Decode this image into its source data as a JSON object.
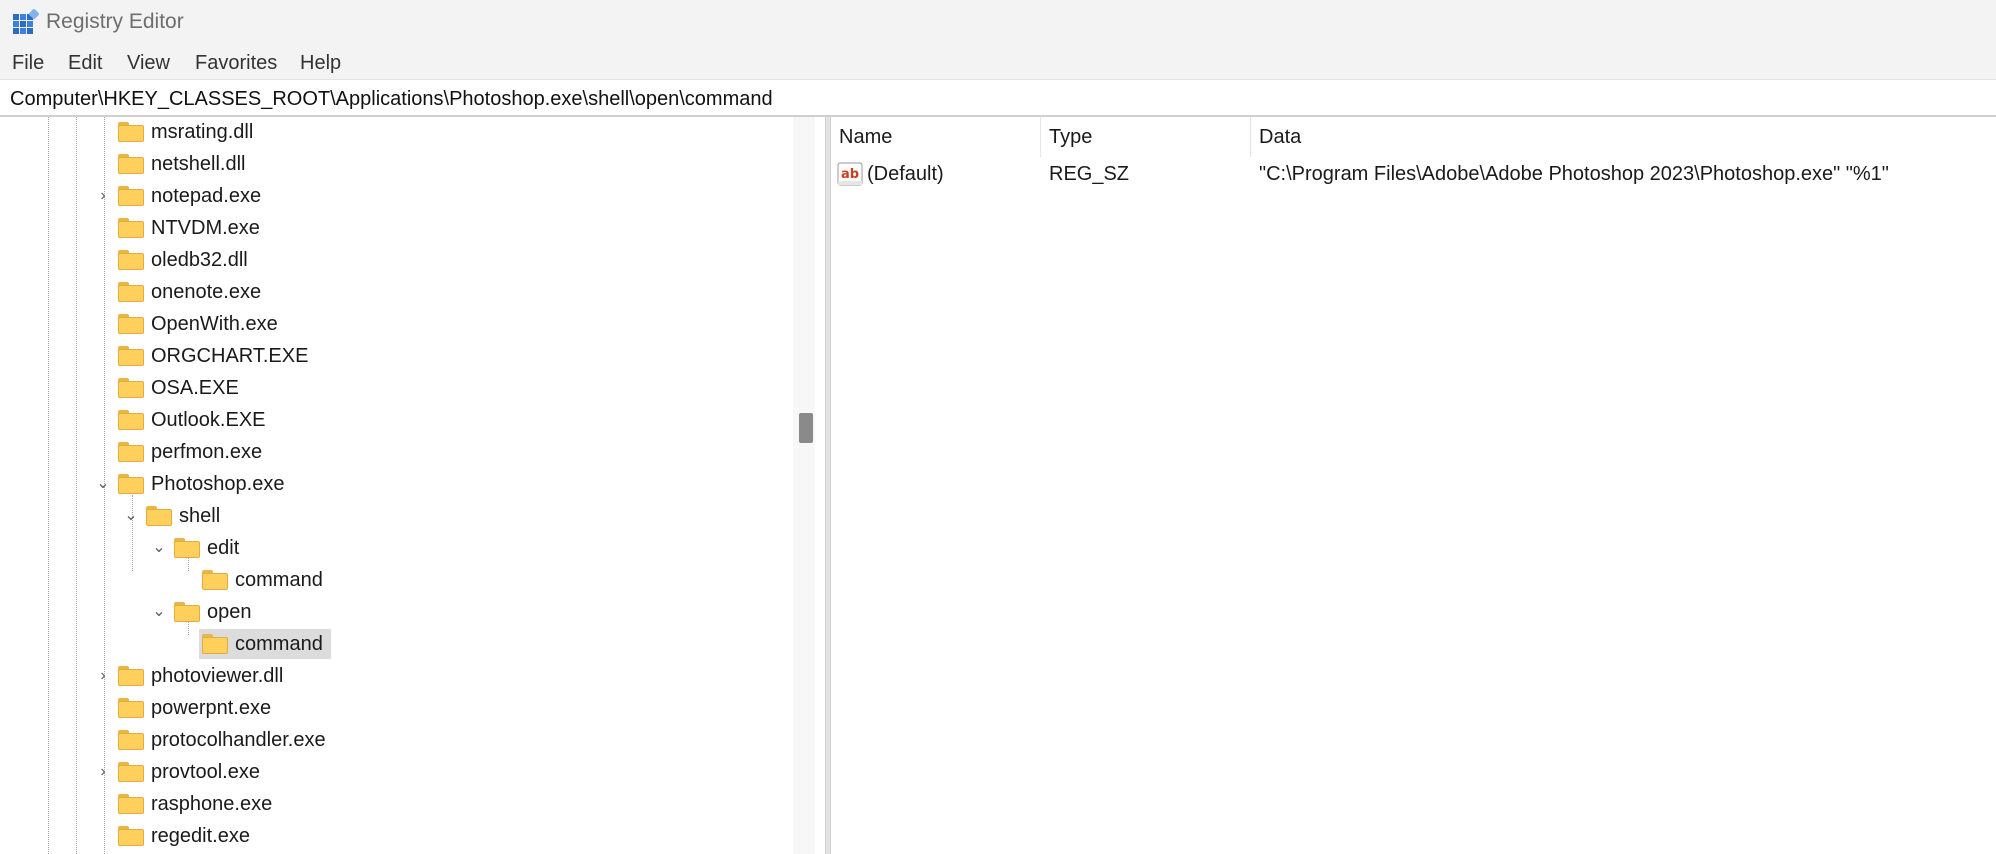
{
  "window": {
    "title": "Registry Editor",
    "app_icon": "regedit-icon"
  },
  "menu": [
    "File",
    "Edit",
    "View",
    "Favorites",
    "Help"
  ],
  "address": "Computer\\HKEY_CLASSES_ROOT\\Applications\\Photoshop.exe\\shell\\open\\command",
  "tree": {
    "items": [
      {
        "label": "msrating.dll",
        "expander": ""
      },
      {
        "label": "netshell.dll",
        "expander": ""
      },
      {
        "label": "notepad.exe",
        "expander": "collapsed"
      },
      {
        "label": "NTVDM.exe",
        "expander": ""
      },
      {
        "label": "oledb32.dll",
        "expander": ""
      },
      {
        "label": "onenote.exe",
        "expander": ""
      },
      {
        "label": "OpenWith.exe",
        "expander": ""
      },
      {
        "label": "ORGCHART.EXE",
        "expander": ""
      },
      {
        "label": "OSA.EXE",
        "expander": ""
      },
      {
        "label": "Outlook.EXE",
        "expander": ""
      },
      {
        "label": "perfmon.exe",
        "expander": ""
      },
      {
        "label": "Photoshop.exe",
        "expander": "expanded"
      },
      {
        "label": "shell",
        "expander": "expanded"
      },
      {
        "label": "edit",
        "expander": "expanded"
      },
      {
        "label": "command",
        "expander": ""
      },
      {
        "label": "open",
        "expander": "expanded"
      },
      {
        "label": "command",
        "expander": "",
        "selected": true
      },
      {
        "label": "photoviewer.dll",
        "expander": "collapsed"
      },
      {
        "label": "powerpnt.exe",
        "expander": ""
      },
      {
        "label": "protocolhandler.exe",
        "expander": ""
      },
      {
        "label": "provtool.exe",
        "expander": "collapsed"
      },
      {
        "label": "rasphone.exe",
        "expander": ""
      },
      {
        "label": "regedit.exe",
        "expander": ""
      }
    ]
  },
  "list": {
    "columns": {
      "name": "Name",
      "type": "Type",
      "data": "Data"
    },
    "rows": [
      {
        "icon": "string-value-ab-icon",
        "name": "(Default)",
        "type": "REG_SZ",
        "data": "\"C:\\Program Files\\Adobe\\Adobe Photoshop 2023\\Photoshop.exe\" \"%1\""
      }
    ]
  },
  "colors": {
    "selection": "#dcdcdc",
    "folder": "#ffd15c",
    "chrome": "#f3f3f3"
  }
}
